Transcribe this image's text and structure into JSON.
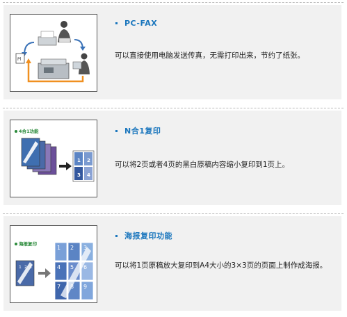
{
  "features": [
    {
      "title": "PC-FAX",
      "description": "可以直接使用电脑发送传真，无需打印出来，节约了纸张。",
      "image_icon": "pc-fax-diagram-icon"
    },
    {
      "title": "N合1复印",
      "description": "可以将2页或者4页的黑白原稿内容缩小复印到1页上。",
      "image_label": "4合1功能",
      "page_numbers": [
        "1",
        "2",
        "3",
        "4"
      ],
      "image_icon": "n-in-1-copy-icon"
    },
    {
      "title": "海报复印功能",
      "description": "可以将1页原稿放大复印到A4大小的3×3页的页面上制作成海报。",
      "image_label": "海报复印",
      "page_numbers": [
        "1",
        "2",
        "3",
        "4",
        "5",
        "6",
        "7",
        "8",
        "9"
      ],
      "image_icon": "poster-copy-icon"
    }
  ],
  "colors": {
    "accent": "#1a76bd",
    "panel": "#f1f1f1",
    "divider": "#b9b9b9",
    "green_label": "#2a8a3a"
  }
}
